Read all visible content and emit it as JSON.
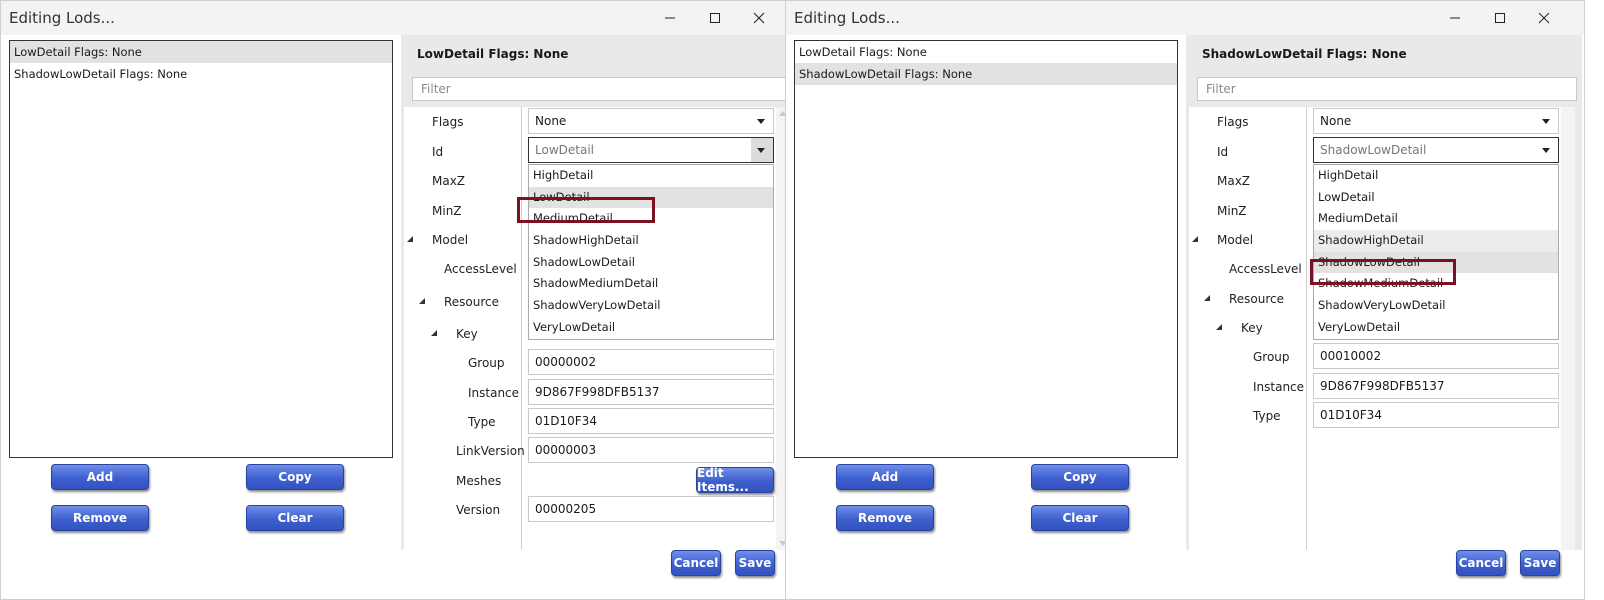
{
  "dialogs": [
    {
      "title": "Editing Lods...",
      "list_items": [
        {
          "label": "LowDetail Flags: None",
          "selected": true
        },
        {
          "label": "ShadowLowDetail Flags: None",
          "selected": false
        }
      ],
      "buttons": {
        "add": "Add",
        "copy": "Copy",
        "remove": "Remove",
        "clear": "Clear",
        "cancel": "Cancel",
        "save": "Save"
      },
      "panel_title": "LowDetail Flags: None",
      "filter_placeholder": "Filter",
      "properties": {
        "flags": {
          "label": "Flags",
          "value": "None"
        },
        "id": {
          "label": "Id",
          "value": "LowDetail"
        },
        "maxz": {
          "label": "MaxZ"
        },
        "minz": {
          "label": "MinZ"
        },
        "model": {
          "label": "Model"
        },
        "accesslevel": {
          "label": "AccessLevel"
        },
        "resource": {
          "label": "Resource"
        },
        "key": {
          "label": "Key"
        },
        "group": {
          "label": "Group",
          "value": "00000002"
        },
        "instance": {
          "label": "Instance",
          "value": "9D867F998DFB5137"
        },
        "type": {
          "label": "Type",
          "value": "01D10F34"
        },
        "linkversion": {
          "label": "LinkVersion",
          "value": "00000003"
        },
        "meshes": {
          "label": "Meshes",
          "button": "Edit Items..."
        },
        "version": {
          "label": "Version",
          "value": "00000205"
        }
      },
      "dropdown_options": [
        "HighDetail",
        "LowDetail",
        "MediumDetail",
        "ShadowHighDetail",
        "ShadowLowDetail",
        "ShadowMediumDetail",
        "ShadowVeryLowDetail",
        "VeryLowDetail"
      ],
      "dropdown_highlighted": "LowDetail",
      "dropdown_annotated": "HighDetail"
    },
    {
      "title": "Editing Lods...",
      "list_items": [
        {
          "label": "LowDetail Flags: None",
          "selected": false
        },
        {
          "label": "ShadowLowDetail Flags: None",
          "selected": true
        }
      ],
      "buttons": {
        "add": "Add",
        "copy": "Copy",
        "remove": "Remove",
        "clear": "Clear",
        "cancel": "Cancel",
        "save": "Save"
      },
      "panel_title": "ShadowLowDetail Flags: None",
      "filter_placeholder": "Filter",
      "properties": {
        "flags": {
          "label": "Flags",
          "value": "None"
        },
        "id": {
          "label": "Id",
          "value": "ShadowLowDetail"
        },
        "maxz": {
          "label": "MaxZ"
        },
        "minz": {
          "label": "MinZ"
        },
        "model": {
          "label": "Model"
        },
        "accesslevel": {
          "label": "AccessLevel"
        },
        "resource": {
          "label": "Resource"
        },
        "key": {
          "label": "Key"
        },
        "group": {
          "label": "Group",
          "value": "00010002"
        },
        "instance": {
          "label": "Instance",
          "value": "9D867F998DFB5137"
        },
        "type": {
          "label": "Type",
          "value": "01D10F34"
        }
      },
      "dropdown_options": [
        "HighDetail",
        "LowDetail",
        "MediumDetail",
        "ShadowHighDetail",
        "ShadowLowDetail",
        "ShadowMediumDetail",
        "ShadowVeryLowDetail",
        "VeryLowDetail"
      ],
      "dropdown_highlighted": "ShadowLowDetail",
      "dropdown_annotated": "ShadowHighDetail"
    }
  ],
  "icons": {
    "minimize": "minimize-icon",
    "maximize": "maximize-icon",
    "close": "close-icon",
    "expand": "expand-triangle-icon",
    "dropdown": "chevron-down-icon"
  },
  "colors": {
    "button_blue": "#4a6ad8",
    "annotation_red": "#7a1020",
    "selection_gray": "#e2e2e2"
  }
}
